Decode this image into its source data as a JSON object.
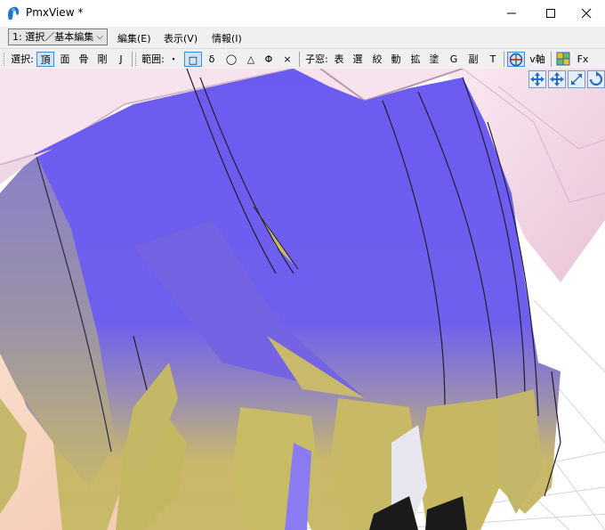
{
  "window": {
    "title": "PmxView *",
    "controls": [
      "minimize",
      "maximize",
      "close"
    ]
  },
  "menubar": {
    "mode_select": "1: 選択／基本編集",
    "menus": [
      "編集(E)",
      "表示(V)",
      "情報(I)"
    ]
  },
  "toolbar": {
    "select_label": "選択:",
    "select_items": [
      "頂",
      "面",
      "骨",
      "剛",
      "J"
    ],
    "selected_item": "頂",
    "range_label": "範囲:",
    "range_items": [
      "・",
      "□",
      "δ",
      "◯",
      "△",
      "Φ",
      "×"
    ],
    "selected_range": "□",
    "subwindow_label": "子窓:",
    "subwindow_items": [
      "表",
      "選",
      "絞",
      "動",
      "拡",
      "塗",
      "G",
      "副",
      "T"
    ],
    "v_axis_label": "v軸",
    "fx_label": "Fx"
  },
  "viewport": {
    "camera_buttons": [
      "move-xy-icon",
      "move-all-icon",
      "zoom-icon",
      "rotate-icon"
    ],
    "colors": {
      "hair_purple": "#6e5ef0",
      "hair_yellow": "#c8b866",
      "skin": "#f6d2c0",
      "pink_cloth": "#f2d8e6",
      "grid_line": "#d8d8d8"
    }
  }
}
